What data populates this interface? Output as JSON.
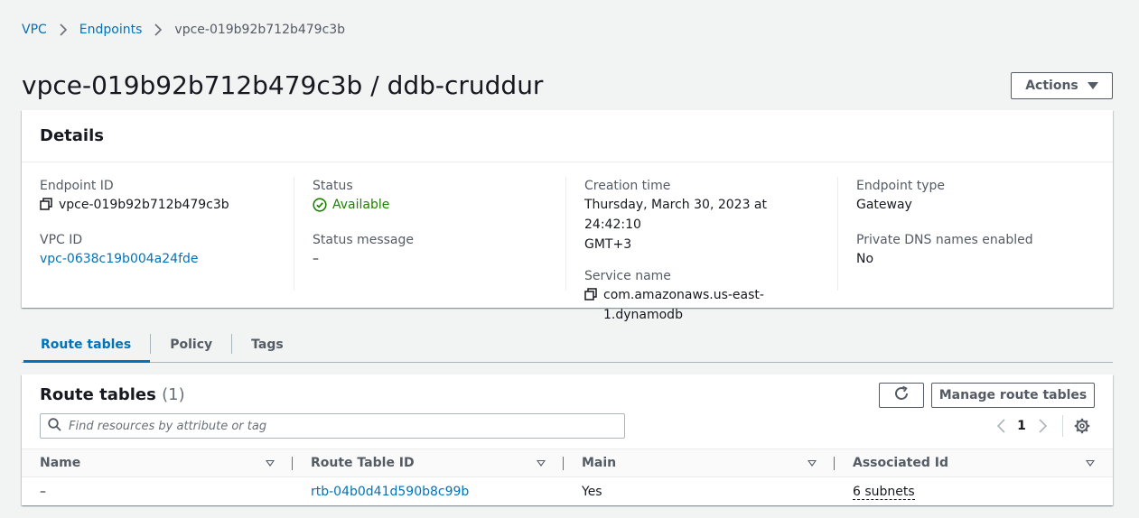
{
  "breadcrumb": {
    "items": [
      "VPC",
      "Endpoints"
    ],
    "current": "vpce-019b92b712b479c3b"
  },
  "header": {
    "title": "vpce-019b92b712b479c3b / ddb-cruddur",
    "actions_label": "Actions"
  },
  "details": {
    "title": "Details",
    "endpoint_id_label": "Endpoint ID",
    "endpoint_id": "vpce-019b92b712b479c3b",
    "vpc_id_label": "VPC ID",
    "vpc_id": "vpc-0638c19b004a24fde",
    "status_label": "Status",
    "status": "Available",
    "status_message_label": "Status message",
    "status_message": "–",
    "creation_time_label": "Creation time",
    "creation_time_line1": "Thursday, March 30, 2023 at 24:42:10",
    "creation_time_line2": "GMT+3",
    "service_name_label": "Service name",
    "service_name": "com.amazonaws.us-east-1.dynamodb",
    "endpoint_type_label": "Endpoint type",
    "endpoint_type": "Gateway",
    "private_dns_label": "Private DNS names enabled",
    "private_dns": "No"
  },
  "tabs": [
    {
      "label": "Route tables",
      "active": true
    },
    {
      "label": "Policy",
      "active": false
    },
    {
      "label": "Tags",
      "active": false
    }
  ],
  "route_tables": {
    "title": "Route tables",
    "count": "(1)",
    "manage_label": "Manage route tables",
    "search_placeholder": "Find resources by attribute or tag",
    "page": "1",
    "columns": [
      "Name",
      "Route Table ID",
      "Main",
      "Associated Id"
    ],
    "rows": [
      {
        "name": "–",
        "route_table_id": "rtb-04b0d41d590b8c99b",
        "main": "Yes",
        "associated_id": "6 subnets"
      }
    ]
  },
  "colors": {
    "link": "#0073bb",
    "success": "#1d8102",
    "background": "#f2f3f3"
  }
}
